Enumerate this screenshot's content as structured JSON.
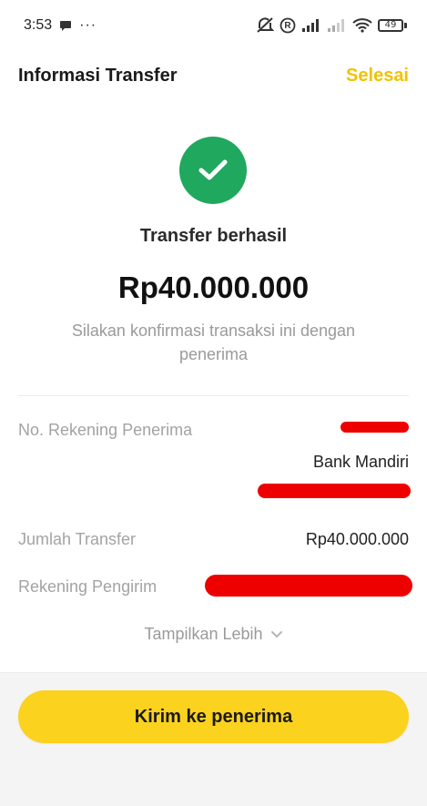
{
  "status_bar": {
    "time": "3:53",
    "icons": [
      "chat-bubble-icon",
      "more-dots-icon",
      "mute-icon",
      "registered-icon",
      "signal-icon",
      "signal-weak-icon",
      "wifi-icon",
      "battery-icon"
    ],
    "battery_level": "49",
    "dots": "···",
    "registered": "R"
  },
  "header": {
    "title": "Informasi Transfer",
    "done_label": "Selesai"
  },
  "success": {
    "title": "Transfer berhasil",
    "amount": "Rp40.000.000",
    "message": "Silakan konfirmasi transaksi ini dengan penerima"
  },
  "details": {
    "recipient_account_label": "No. Rekening Penerima",
    "recipient_bank": "Bank Mandiri",
    "transfer_amount_label": "Jumlah Transfer",
    "transfer_amount_value": "Rp40.000.000",
    "sender_account_label": "Rekening Pengirim"
  },
  "show_more_label": "Tampilkan Lebih",
  "primary_button_label": "Kirim ke penerima",
  "colors": {
    "accent_yellow": "#fbd21e",
    "link_yellow": "#f2c200",
    "success_green": "#1fa85e",
    "redaction_red": "#ee0000"
  }
}
